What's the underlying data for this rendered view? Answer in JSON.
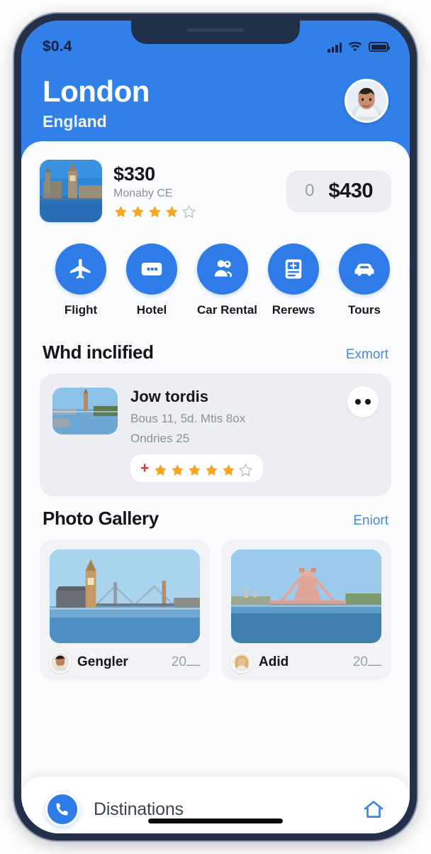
{
  "status_bar": {
    "time": "$0.4",
    "signal_icon": "signal-bars-icon",
    "wifi_icon": "wifi-icon",
    "battery_icon": "battery-icon"
  },
  "header": {
    "city": "London",
    "country": "England",
    "avatar_icon": "user-avatar",
    "bg_color": "#3180ea"
  },
  "price_card": {
    "thumbnail_icon": "big-ben-thumbnail",
    "price": "$330",
    "subtitle": "Monaby CE",
    "rating_filled": 4,
    "rating_total": 5,
    "pill_count": "0",
    "pill_price": "$430"
  },
  "categories": [
    {
      "label": "Flight",
      "icon": "airplane-icon"
    },
    {
      "label": "Hotel",
      "icon": "card-icon"
    },
    {
      "label": "Car Rental",
      "icon": "location-person-icon"
    },
    {
      "label": "Rerews",
      "icon": "document-icon"
    },
    {
      "label": "Tours",
      "icon": "car-icon"
    },
    {
      "label": "",
      "icon": "partial-icon"
    }
  ],
  "included_section": {
    "title": "Whd inclified",
    "link": "Exmort",
    "card": {
      "thumbnail_icon": "river-tower-thumbnail",
      "title": "Jow tordis",
      "meta1": "Bous 11, 5d. Mtis 8ox",
      "meta2": "Ondries 25",
      "plus": "+",
      "rating_filled": 5,
      "rating_total": 6,
      "more_icon": "more-dots-icon"
    }
  },
  "gallery_section": {
    "title": "Photo Gallery",
    "link": "Eniort",
    "items": [
      {
        "image_icon": "big-ben-bridge-photo",
        "avatar_icon": "avatar-gengler",
        "name": "Gengler",
        "count": "20⎼"
      },
      {
        "image_icon": "pink-bridge-photo",
        "avatar_icon": "avatar-adid",
        "name": "Adid",
        "count": "20⎼"
      }
    ]
  },
  "bottom_bar": {
    "phone_icon": "phone-icon",
    "label": "Distinations",
    "home_icon": "home-icon"
  },
  "colors": {
    "brand_blue": "#2f7ce8",
    "header_blue": "#3180ea",
    "link_blue": "#4a87d8",
    "star_gold": "#f5a623",
    "plus_red": "#e03232",
    "bezel": "#22304a"
  }
}
